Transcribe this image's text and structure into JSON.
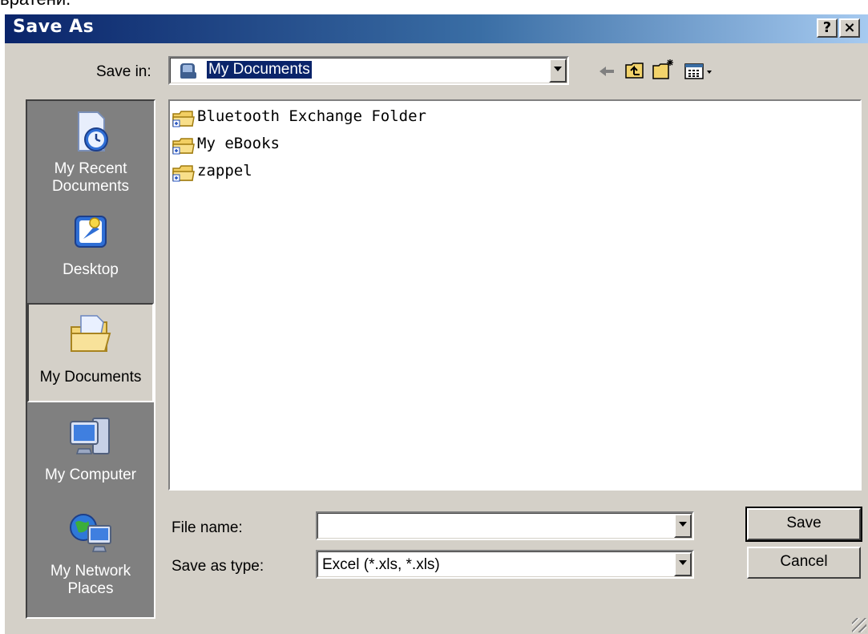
{
  "top_cropped_text": "вратени.",
  "dialog": {
    "title": "Save As",
    "help_button": "?",
    "close_button": "×"
  },
  "save_in": {
    "label": "Save in:",
    "value": "My Documents"
  },
  "places_bar": [
    {
      "label_lines": [
        "My Recent",
        "Documents"
      ],
      "icon": "recent-documents-icon"
    },
    {
      "label_lines": [
        "Desktop"
      ],
      "icon": "desktop-icon"
    },
    {
      "label_lines": [
        "My Documents"
      ],
      "icon": "my-documents-icon",
      "selected": true
    },
    {
      "label_lines": [
        "My Computer"
      ],
      "icon": "my-computer-icon"
    },
    {
      "label_lines": [
        "My Network",
        "Places"
      ],
      "icon": "network-places-icon"
    }
  ],
  "files": [
    {
      "name": "Bluetooth Exchange Folder",
      "icon": "folder-icon"
    },
    {
      "name": "My eBooks",
      "icon": "folder-icon"
    },
    {
      "name": "zappel",
      "icon": "folder-icon"
    }
  ],
  "file_name": {
    "label": "File name:",
    "value": ""
  },
  "save_as_type": {
    "label": "Save as type:",
    "value": "Excel (*.xls, *.xls)"
  },
  "buttons": {
    "save": "Save",
    "cancel": "Cancel"
  },
  "colors": {
    "title_start": "#0a246a",
    "title_end": "#a6caf0",
    "face": "#d4d0c8",
    "places_bg": "#808080"
  }
}
